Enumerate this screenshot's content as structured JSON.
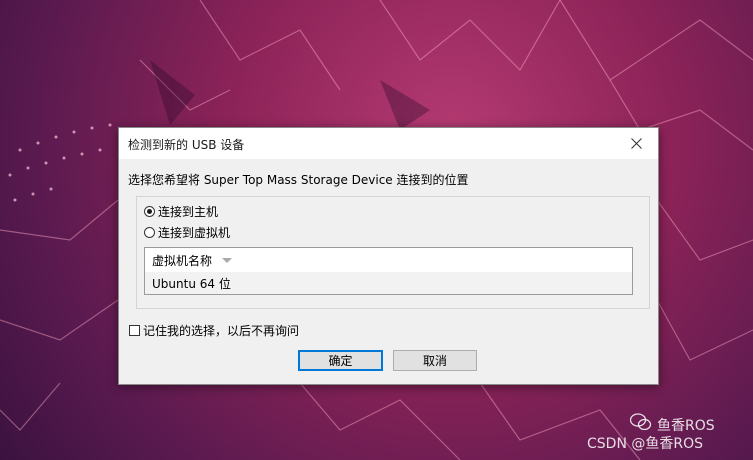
{
  "dialog": {
    "title": "检测到新的 USB 设备",
    "close_glyph": "✕",
    "prompt": "选择您希望将 Super Top Mass Storage Device 连接到的位置",
    "options": [
      {
        "label": "连接到主机",
        "checked": true
      },
      {
        "label": "连接到虚拟机",
        "checked": false
      }
    ],
    "vm_list": {
      "header": "虚拟机名称",
      "items": [
        "Ubuntu 64 位"
      ]
    },
    "remember_label": "记住我的选择，以后不再询问",
    "remember_checked": false,
    "ok_label": "确定",
    "cancel_label": "取消"
  },
  "watermark": {
    "account": "鱼香ROS",
    "source": "CSDN @鱼香ROS"
  },
  "colors": {
    "dialog_bg": "#f0f0f0",
    "accent": "#0078d7",
    "wallpaper": "#8c2358"
  }
}
